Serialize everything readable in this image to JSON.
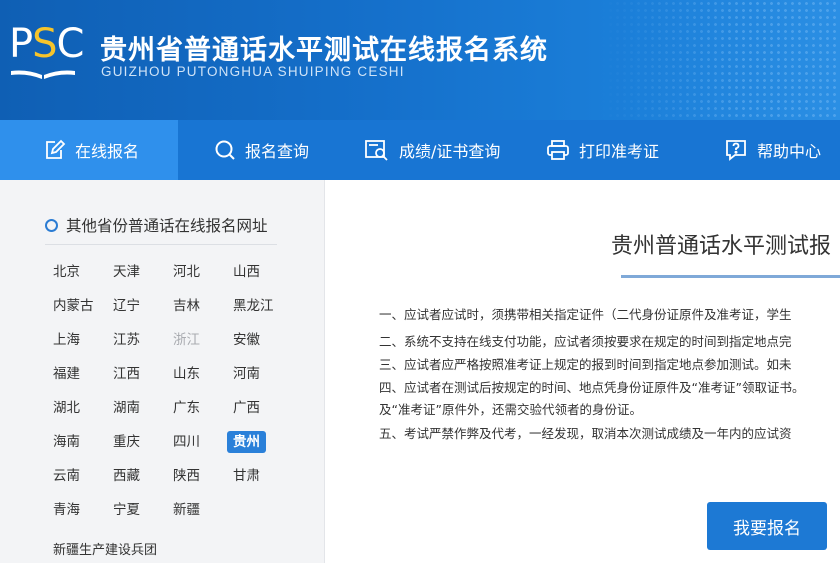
{
  "header": {
    "logo": {
      "text_p": "P",
      "text_s": "S",
      "text_c": "C"
    },
    "title": "贵州省普通话水平测试在线报名系统",
    "subtitle": "GUIZHOU PUTONGHUA SHUIPING CESHI"
  },
  "nav": [
    {
      "label": "在线报名",
      "icon": "edit-icon",
      "active": true
    },
    {
      "label": "报名查询",
      "icon": "search-icon",
      "active": false
    },
    {
      "label": "成绩/证书查询",
      "icon": "certificate-search-icon",
      "active": false
    },
    {
      "label": "打印准考证",
      "icon": "printer-icon",
      "active": false
    },
    {
      "label": "帮助中心",
      "icon": "help-icon",
      "active": false
    }
  ],
  "sidebar": {
    "title": "其他省份普通话在线报名网址",
    "provinces": [
      "北京",
      "天津",
      "河北",
      "山西",
      "内蒙古",
      "辽宁",
      "吉林",
      "黑龙江",
      "上海",
      "江苏",
      "浙江",
      "安徽",
      "福建",
      "江西",
      "山东",
      "河南",
      "湖北",
      "湖南",
      "广东",
      "广西",
      "海南",
      "重庆",
      "四川",
      "贵州",
      "云南",
      "西藏",
      "陕西",
      "甘肃",
      "青海",
      "宁夏",
      "新疆",
      "新疆生产建设兵团"
    ],
    "active_province": "贵州",
    "disabled_province": "浙江"
  },
  "main": {
    "title": "贵州普通话水平测试报",
    "notices": [
      "一、应试者应试时，须携带相关指定证件（二代身份证原件及准考证，学生",
      "二、系统不支持在线支付功能，应试者须按要求在规定的时间到指定地点完",
      "三、应试者应严格按照准考证上规定的报到时间到指定地点参加测试。如未",
      "四、应试者在测试后按规定的时间、地点凭身份证原件及“准考证”领取证书。",
      "及“准考证”原件外，还需交验代领者的身份证。",
      "五、考试严禁作弊及代考，一经发现，取消本次测试成绩及一年内的应试资"
    ],
    "apply_button": "我要报名"
  },
  "colors": {
    "header_blue": "#1570cb",
    "nav_blue": "#1875d3",
    "nav_active": "#2f90ec",
    "logo_yellow": "#f6c42b",
    "button_blue": "#1d79d4"
  }
}
